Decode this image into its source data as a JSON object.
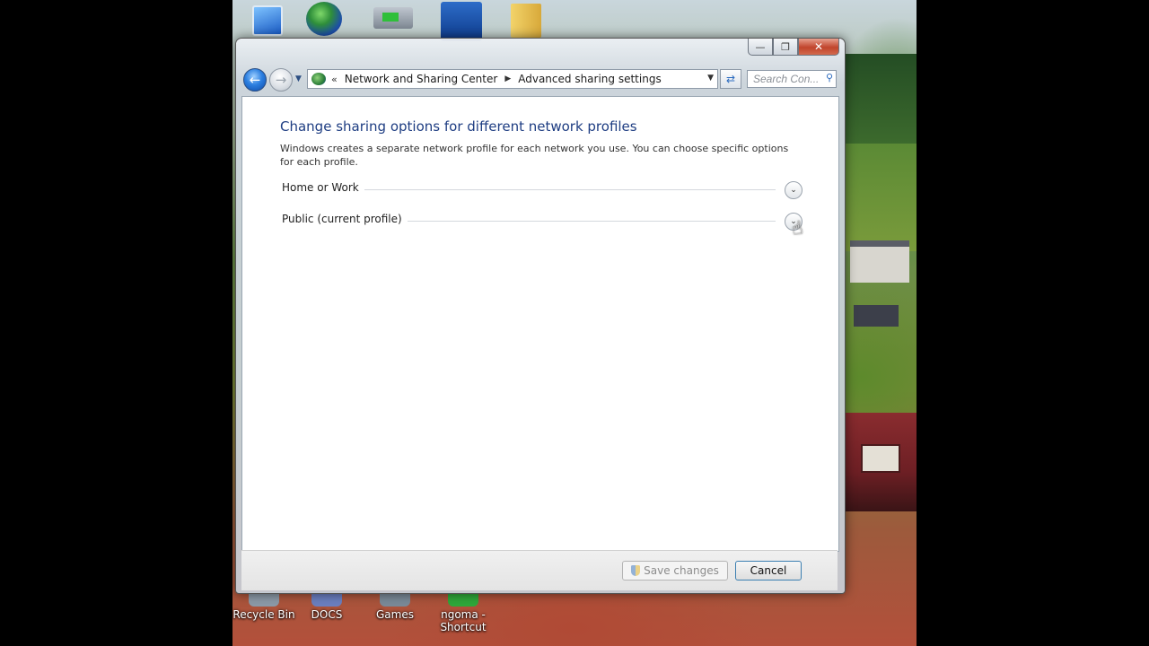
{
  "desktop": {
    "icons_bottom": [
      {
        "label": "Recycle Bin"
      },
      {
        "label": "DOCS"
      },
      {
        "label": "Games"
      },
      {
        "label": "ngoma - Shortcut"
      }
    ],
    "top_icons": [
      "computer-icon",
      "internet-globe-icon",
      "network-icon",
      "user-folder-icon",
      "folder-icon"
    ]
  },
  "window": {
    "address_bar": {
      "chevron": "«",
      "crumbs": [
        "Network and Sharing Center",
        "Advanced sharing settings"
      ]
    },
    "search": {
      "placeholder": "Search Con..."
    },
    "content": {
      "heading": "Change sharing options for different network profiles",
      "description": "Windows creates a separate network profile for each network you use. You can choose specific options for each profile.",
      "profiles": [
        {
          "label": "Home or Work",
          "state": "collapsed"
        },
        {
          "label": "Public (current profile)",
          "state": "collapsed"
        }
      ]
    },
    "buttons": {
      "save": "Save changes",
      "cancel": "Cancel"
    }
  }
}
